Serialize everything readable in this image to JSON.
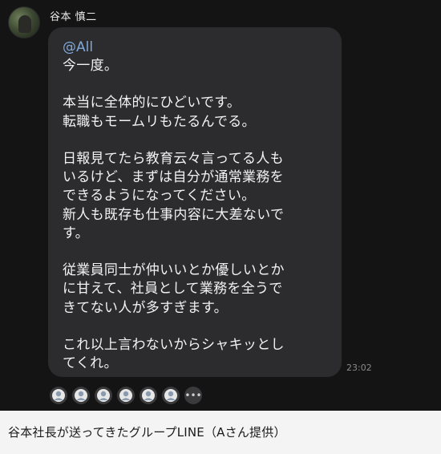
{
  "chat": {
    "sender_name": "谷本 慎二",
    "mention": "@All",
    "message_lines": [
      "今一度。",
      "",
      "本当に全体的にひどいです。",
      "転職もモームリもたるんでる。",
      "",
      "日報見てたら教育云々言ってる人も",
      "いるけど、まずは自分が通常業務を",
      "できるようになってください。",
      "新人も既存も仕事内容に大差ないで",
      "す。",
      "",
      "従業員同士が仲いいとか優しいとか",
      "に甘えて、社員として業務を全うで",
      "きてない人が多すぎます。",
      "",
      "これ以上言わないからシャキッとし",
      "てくれ。"
    ],
    "timestamp": "23:02",
    "reaction_icons": [
      "read-avatar-icon",
      "read-avatar-icon",
      "read-avatar-icon",
      "read-avatar-icon",
      "read-avatar-icon",
      "read-avatar-icon"
    ],
    "more_label": "•••"
  },
  "caption": "谷本社長が送ってきたグループLINE（Aさん提供）",
  "colors": {
    "screen_bg": "#141414",
    "bubble_bg": "#2c2c2e",
    "mention": "#7fa8d9",
    "text": "#f2f2f2",
    "caption_bg": "#f4f4f4"
  }
}
